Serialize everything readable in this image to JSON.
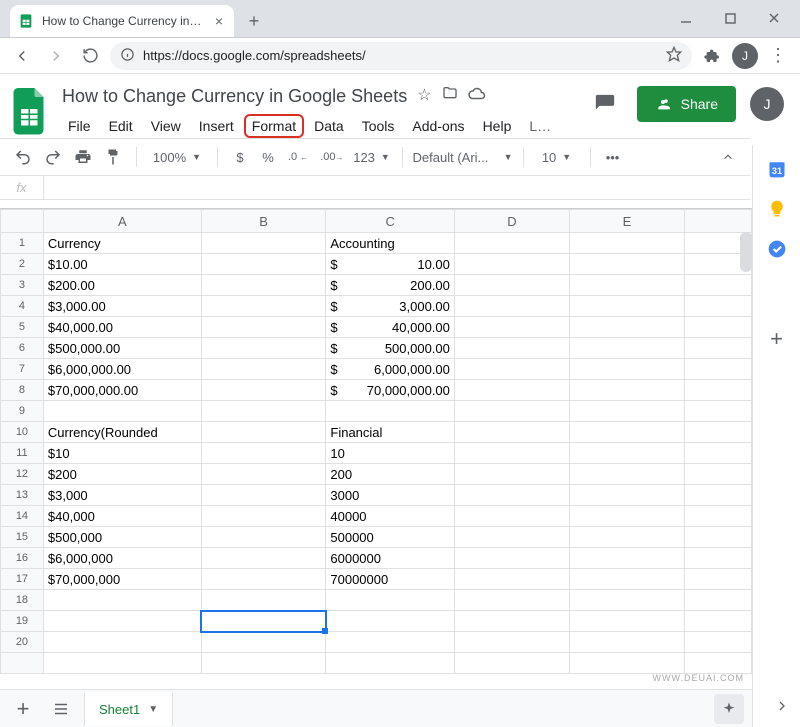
{
  "browser": {
    "tab_title": "How to Change Currency in Goo",
    "url": "https://docs.google.com/spreadsheets/",
    "avatar_letter": "J"
  },
  "doc": {
    "title": "How to Change Currency in Google Sheets",
    "avatar_letter": "J"
  },
  "menubar": {
    "file": "File",
    "edit": "Edit",
    "view": "View",
    "insert": "Insert",
    "format": "Format",
    "data": "Data",
    "tools": "Tools",
    "addons": "Add-ons",
    "help": "Help",
    "last": "L…"
  },
  "share_label": "Share",
  "toolbar": {
    "zoom": "100%",
    "dollar": "$",
    "percent": "%",
    "dec0": ".0",
    "dec00": ".00",
    "num123": "123",
    "font": "Default (Ari...",
    "fontsize": "10",
    "more": "•••"
  },
  "fx_label": "fx",
  "columns": {
    "A": "A",
    "B": "B",
    "C": "C",
    "D": "D",
    "E": "E"
  },
  "rows": {
    "r1": "1",
    "r2": "2",
    "r3": "3",
    "r4": "4",
    "r5": "5",
    "r6": "6",
    "r7": "7",
    "r8": "8",
    "r9": "9",
    "r10": "10",
    "r11": "11",
    "r12": "12",
    "r13": "13",
    "r14": "14",
    "r15": "15",
    "r16": "16",
    "r17": "17",
    "r18": "18",
    "r19": "19",
    "r20": "20"
  },
  "cells": {
    "A1": "Currency",
    "A2": "$10.00",
    "A3": "$200.00",
    "A4": "$3,000.00",
    "A5": "$40,000.00",
    "A6": "$500,000.00",
    "A7": "$6,000,000.00",
    "A8": "$70,000,000.00",
    "A10": "Currency(Rounded",
    "A11": "$10",
    "A12": "$200",
    "A13": "$3,000",
    "A14": "$40,000",
    "A15": "$500,000",
    "A16": "$6,000,000",
    "A17": "$70,000,000",
    "C1": "Accounting",
    "C10": "Financial",
    "C11": "10",
    "C12": "200",
    "C13": "3000",
    "C14": "40000",
    "C15": "500000",
    "C16": "6000000",
    "C17": "70000000"
  },
  "acc": {
    "sym": "$",
    "v2": "10.00",
    "v3": "200.00",
    "v4": "3,000.00",
    "v5": "40,000.00",
    "v6": "500,000.00",
    "v7": "6,000,000.00",
    "v8": "70,000,000.00"
  },
  "sheet_tab": "Sheet1",
  "watermark": "WWW.DEUAI.COM"
}
